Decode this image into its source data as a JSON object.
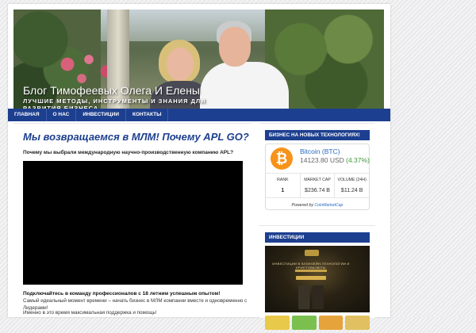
{
  "header": {
    "title": "Блог Тимофеевых Олега И Елены",
    "subtitle": "Лучшие методы, инструменты и знания для развития бизнеса"
  },
  "nav": {
    "items": [
      "Главная",
      "О нас",
      "Инвестиции",
      "Контакты"
    ]
  },
  "post": {
    "title": "Мы возвращаемся в МЛМ! Почему APL GO?",
    "subtitle": "Почему мы выбрали международную научно-производственную компанию APL?",
    "p1": "Подключайтесь в команду профессионалов с 18 летним успешным опытом!",
    "p2": "Самый идеальный момент времени – начать бизнес в МЛМ компании вместе и одновременно с Лидерами!",
    "p3": "Именно в это время максимальная поддержка и помощь!"
  },
  "sidebar": {
    "widget1_title": "Бизнес на новых технологиях!",
    "coin": {
      "symbol": "₿",
      "name": "Bitcoin (BTC)",
      "price": "14123.80 USD",
      "change": "(4.37%)",
      "rank_label": "RANK",
      "rank": "1",
      "mcap_label": "MARKET CAP",
      "mcap": "$236.74 B",
      "volume_label": "VOLUME (24H)",
      "volume": "$11.24 B",
      "powered_prefix": "Powered by",
      "powered_by": "CoinMarketCap"
    },
    "widget2_title": "Инвестиции",
    "invest_banner_text": "ИНВЕСТИЦИИ В БЛОКЧЕЙН-ТЕХНОЛОГИИ И КРИПТОВАЛЮТЫ"
  },
  "colors": {
    "nav": "#1d3f8f",
    "title": "#1d3f8f",
    "bitcoin": "#f7931a",
    "positive": "#3a9a3a"
  }
}
